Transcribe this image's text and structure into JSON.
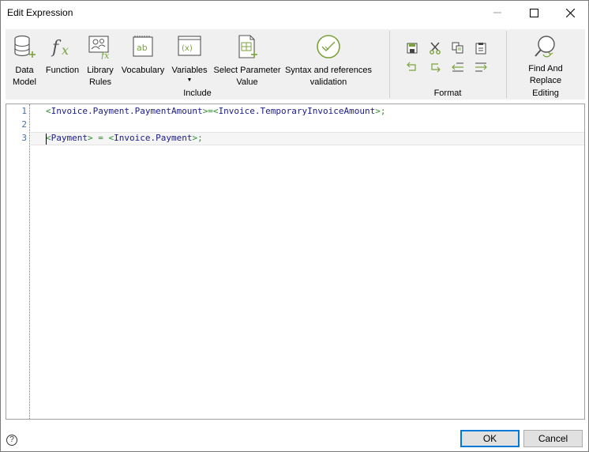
{
  "window": {
    "title": "Edit Expression"
  },
  "ribbon": {
    "include": {
      "label": "Include",
      "items": [
        {
          "id": "data-model",
          "label": "Data\nModel",
          "icon": "database-add-icon"
        },
        {
          "id": "function",
          "label": "Function",
          "icon": "function-fx-icon"
        },
        {
          "id": "library-rules",
          "label": "Library\nRules",
          "icon": "library-rules-icon"
        },
        {
          "id": "vocabulary",
          "label": "Vocabulary",
          "icon": "vocabulary-book-icon"
        },
        {
          "id": "variables",
          "label": "Variables",
          "icon": "variables-icon",
          "dropdown": "▼"
        },
        {
          "id": "select-parameter-value",
          "label": "Select Parameter\nValue",
          "icon": "select-parameter-icon"
        },
        {
          "id": "syntax-validation",
          "label": "Syntax and references\nvalidation",
          "icon": "check-circle-icon"
        }
      ]
    },
    "format": {
      "label": "Format",
      "buttons": [
        "save-icon",
        "cut-icon",
        "copy-icon",
        "paste-icon",
        "undo-icon",
        "redo-icon",
        "outdent-icon",
        "indent-icon"
      ]
    },
    "editing": {
      "label": "Editing",
      "items": [
        {
          "id": "find-replace",
          "label": "Find And\nReplace",
          "icon": "find-replace-icon"
        }
      ]
    }
  },
  "editor": {
    "lines": [
      {
        "num": "1",
        "tokens": [
          {
            "t": "<",
            "k": "br"
          },
          {
            "t": "Invoice.Payment.PaymentAmount",
            "k": "id"
          },
          {
            "t": ">=<",
            "k": "br"
          },
          {
            "t": "Invoice.TemporaryInvoiceAmount",
            "k": "id"
          },
          {
            "t": ">;",
            "k": "br"
          }
        ]
      },
      {
        "num": "2",
        "tokens": []
      },
      {
        "num": "3",
        "tokens": [
          {
            "t": "<",
            "k": "br"
          },
          {
            "t": "Payment",
            "k": "id"
          },
          {
            "t": "> = <",
            "k": "br"
          },
          {
            "t": "Invoice.Payment",
            "k": "id"
          },
          {
            "t": ">;",
            "k": "br"
          }
        ]
      }
    ]
  },
  "footer": {
    "help": "?",
    "ok_label": "OK",
    "cancel_label": "Cancel"
  },
  "colors": {
    "accent_green": "#7aa33c",
    "bracket_green": "#2e8b2e",
    "identifier_blue": "#1a1a8a",
    "line_number_blue": "#4a6fa5"
  }
}
